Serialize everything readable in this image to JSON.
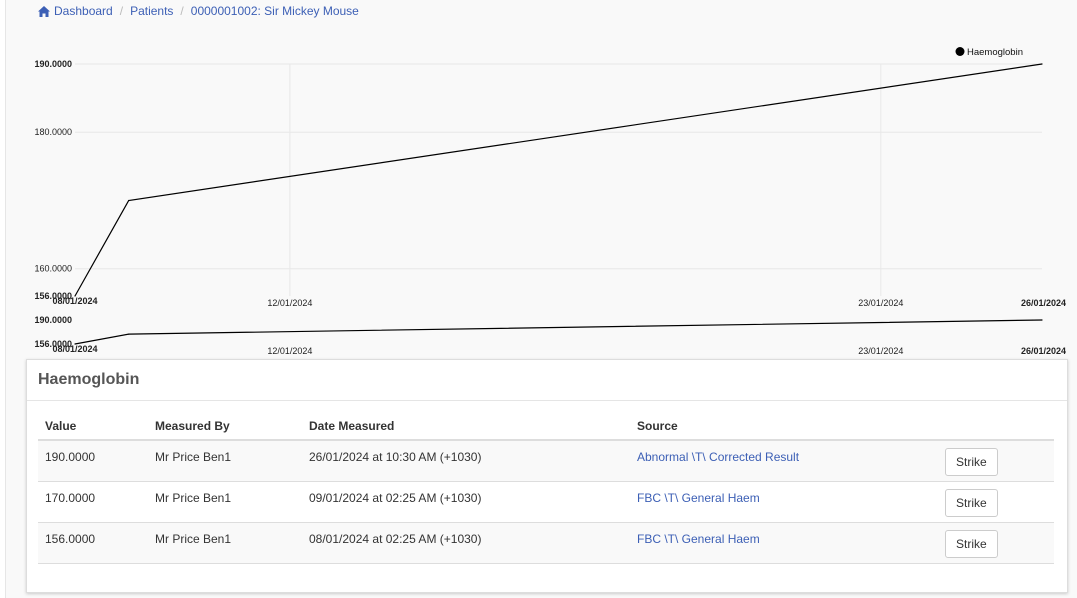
{
  "breadcrumb": {
    "items": [
      {
        "label": "Dashboard",
        "icon": "home-icon"
      },
      {
        "label": "Patients"
      },
      {
        "label": "0000001002: Sir Mickey Mouse"
      }
    ]
  },
  "chart_data": [
    {
      "type": "line",
      "x": [
        "08/01/2024",
        "09/01/2024",
        "26/01/2024"
      ],
      "y": [
        156.0,
        170.0,
        190.0
      ],
      "xlim": [
        "08/01/2024",
        "26/01/2024"
      ],
      "ylim": [
        156.0,
        190.0
      ],
      "x_ticks": [
        "08/01/2024",
        "12/01/2024",
        "23/01/2024",
        "26/01/2024"
      ],
      "y_ticks": [
        "156.0000",
        "160.0000",
        "180.0000",
        "190.0000"
      ],
      "series": [
        {
          "name": "Haemoglobin",
          "color": "#000000"
        }
      ],
      "legend": "top-right",
      "grid": true
    },
    {
      "type": "line",
      "x": [
        "08/01/2024",
        "09/01/2024",
        "26/01/2024"
      ],
      "y": [
        156.0,
        170.0,
        190.0
      ],
      "xlim": [
        "08/01/2024",
        "26/01/2024"
      ],
      "ylim": [
        156.0,
        190.0
      ],
      "x_ticks": [
        "08/01/2024",
        "12/01/2024",
        "23/01/2024",
        "26/01/2024"
      ],
      "y_ticks": [
        "156.0000",
        "190.0000"
      ],
      "grid": false
    }
  ],
  "panel": {
    "title": "Haemoglobin",
    "columns": [
      "Value",
      "Measured By",
      "Date Measured",
      "Source"
    ],
    "rows": [
      {
        "value": "190.0000",
        "measured_by": "Mr Price Ben1",
        "date": "26/01/2024 at 10:30 AM (+1030)",
        "source": "Abnormal \\T\\ Corrected Result",
        "action": "Strike"
      },
      {
        "value": "170.0000",
        "measured_by": "Mr Price Ben1",
        "date": "09/01/2024 at 02:25 AM (+1030)",
        "source": "FBC \\T\\ General Haem",
        "action": "Strike"
      },
      {
        "value": "156.0000",
        "measured_by": "Mr Price Ben1",
        "date": "08/01/2024 at 02:25 AM (+1030)",
        "source": "FBC \\T\\ General Haem",
        "action": "Strike"
      }
    ]
  },
  "colors": {
    "link": "#3c5fb5",
    "line": "#000000",
    "grid": "#e8e8e8"
  }
}
